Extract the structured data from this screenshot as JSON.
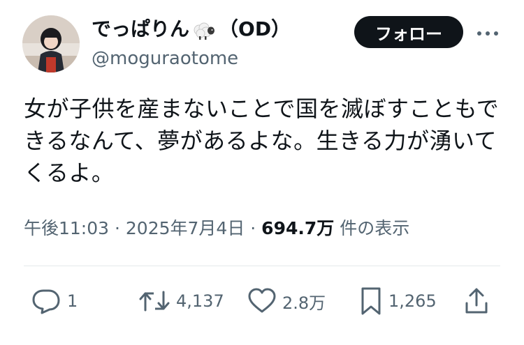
{
  "author": {
    "display_name": "でっぱりん",
    "name_badge": "（OD）",
    "handle": "@moguraotome",
    "name_emoji_icon": "sheep-icon"
  },
  "follow_button": {
    "label": "フォロー"
  },
  "more_button": {
    "icon": "more-horizontal-icon"
  },
  "tweet": {
    "text": "女が子供を産まないことで国を滅ぼすこともで\nきるなんて、夢があるよな。生きる力が湧いて\nくるよ。"
  },
  "meta": {
    "time": "午後11:03",
    "separator": " · ",
    "date": "2025年7月4日",
    "views": "694.7万",
    "views_label": " 件の表示"
  },
  "actions": {
    "reply": {
      "icon": "reply-icon",
      "count": "1"
    },
    "repost": {
      "icon": "repost-icon",
      "count": "4,137"
    },
    "like": {
      "icon": "heart-icon",
      "count": "2.8万"
    },
    "bookmark": {
      "icon": "bookmark-icon",
      "count": "1,265"
    },
    "share": {
      "icon": "share-icon"
    }
  },
  "colors": {
    "text_primary": "#0f1419",
    "text_secondary": "#536471",
    "follow_bg": "#0f1419",
    "divider": "#e5e9eb"
  }
}
